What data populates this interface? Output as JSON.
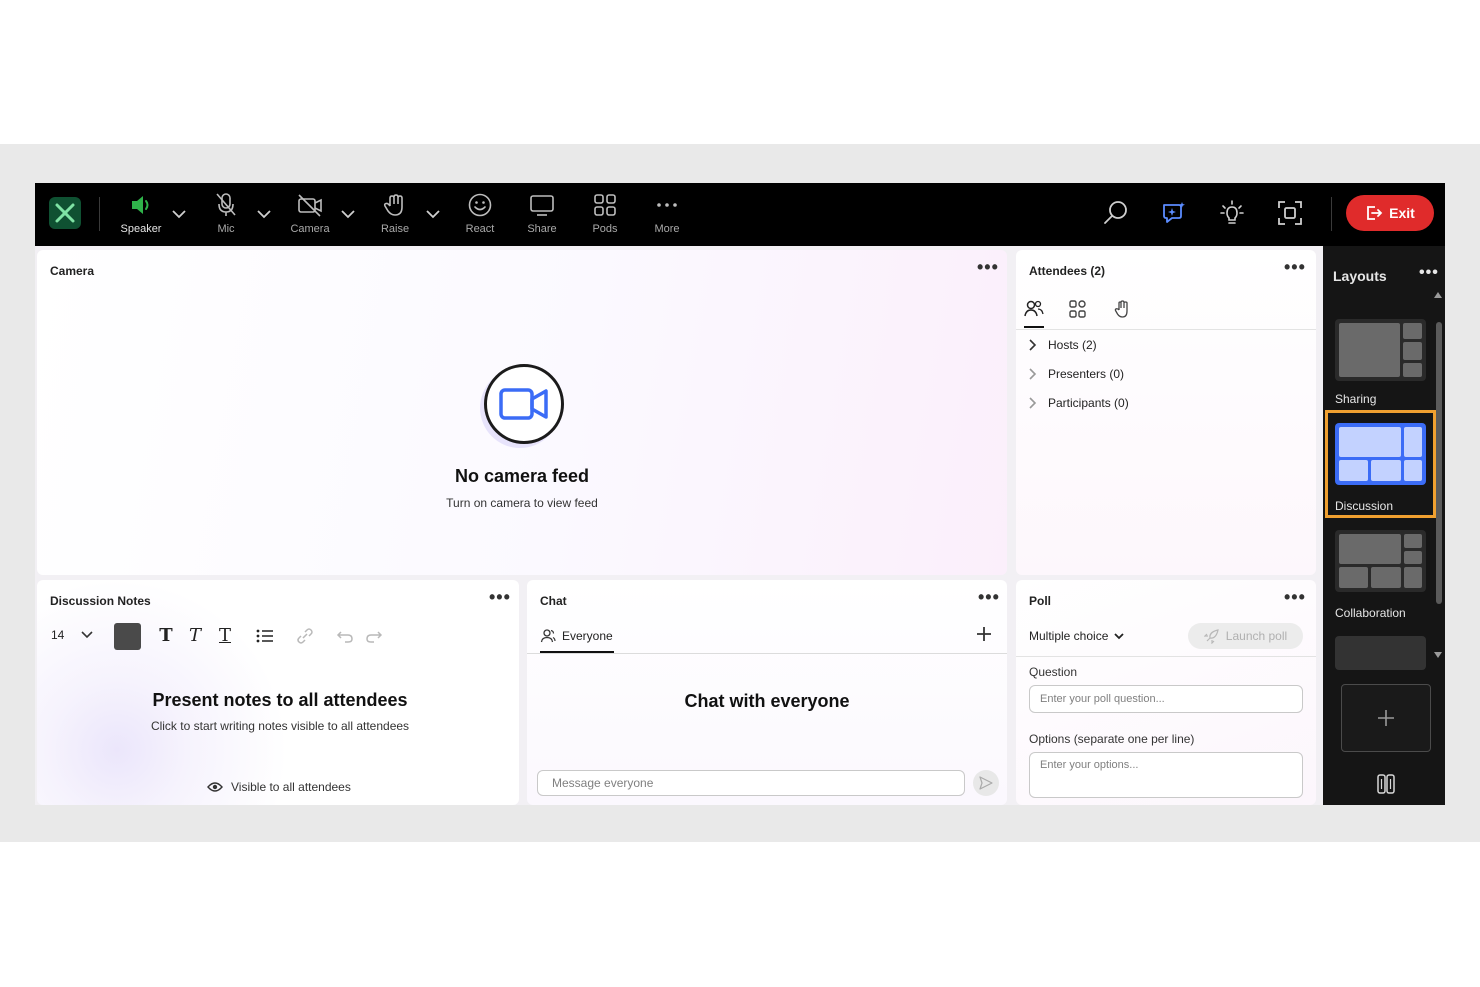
{
  "toolbar": {
    "speaker": "Speaker",
    "mic": "Mic",
    "camera": "Camera",
    "raise": "Raise",
    "react": "React",
    "share": "Share",
    "pods": "Pods",
    "more": "More",
    "exit": "Exit"
  },
  "camera_pod": {
    "title": "Camera",
    "headline": "No camera feed",
    "sub": "Turn on camera to view feed"
  },
  "attendees_pod": {
    "title": "Attendees (2)",
    "groups": [
      "Hosts (2)",
      "Presenters (0)",
      "Participants (0)"
    ]
  },
  "notes_pod": {
    "title": "Discussion Notes",
    "font_size": "14",
    "headline": "Present notes to all attendees",
    "sub": "Click to start writing notes visible to all attendees",
    "visibility": "Visible to all attendees"
  },
  "chat_pod": {
    "title": "Chat",
    "tab": "Everyone",
    "headline": "Chat with everyone",
    "placeholder": "Message everyone"
  },
  "poll_pod": {
    "title": "Poll",
    "type": "Multiple choice",
    "launch": "Launch poll",
    "question_label": "Question",
    "question_placeholder": "Enter your poll question...",
    "options_label": "Options (separate one per line)",
    "options_placeholder": "Enter your options..."
  },
  "layouts": {
    "title": "Layouts",
    "items": [
      "Sharing",
      "Discussion",
      "Collaboration"
    ],
    "selected": "Discussion",
    "selection_color": "#f0a030"
  },
  "colors": {
    "exit": "#e02b2b",
    "speaker_active": "#2fb34a",
    "accent_blue": "#3b6cf6"
  }
}
